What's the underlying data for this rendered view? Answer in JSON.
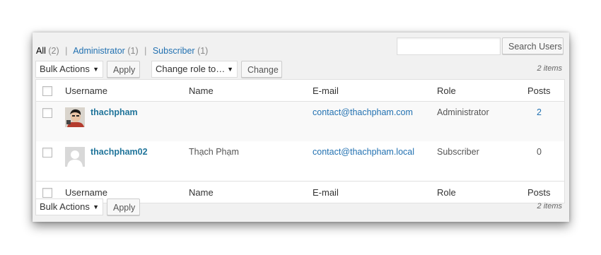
{
  "filters": [
    {
      "label": "All",
      "count": "(2)",
      "current": true
    },
    {
      "label": "Administrator",
      "count": "(1)",
      "current": false
    },
    {
      "label": "Subscriber",
      "count": "(1)",
      "current": false
    }
  ],
  "separator": "|",
  "search": {
    "value": "",
    "button": "Search Users"
  },
  "top_nav": {
    "bulk_actions": "Bulk Actions",
    "apply": "Apply",
    "change_role": "Change role to…",
    "change": "Change",
    "items": "2 items"
  },
  "bottom_nav": {
    "bulk_actions": "Bulk Actions",
    "apply": "Apply",
    "items": "2 items"
  },
  "columns": {
    "username": "Username",
    "name": "Name",
    "email": "E-mail",
    "role": "Role",
    "posts": "Posts"
  },
  "users": [
    {
      "username": "thachpham",
      "name": "",
      "email": "contact@thachpham.com",
      "role": "Administrator",
      "posts": "2",
      "avatar": "photo-avatar-icon"
    },
    {
      "username": "thachpham02",
      "name": "Thạch Phạm",
      "email": "contact@thachpham.local",
      "role": "Subscriber",
      "posts": "0",
      "avatar": "default-avatar-icon"
    }
  ],
  "colors": {
    "link": "#21759b",
    "panel": "#f1f1f1"
  }
}
